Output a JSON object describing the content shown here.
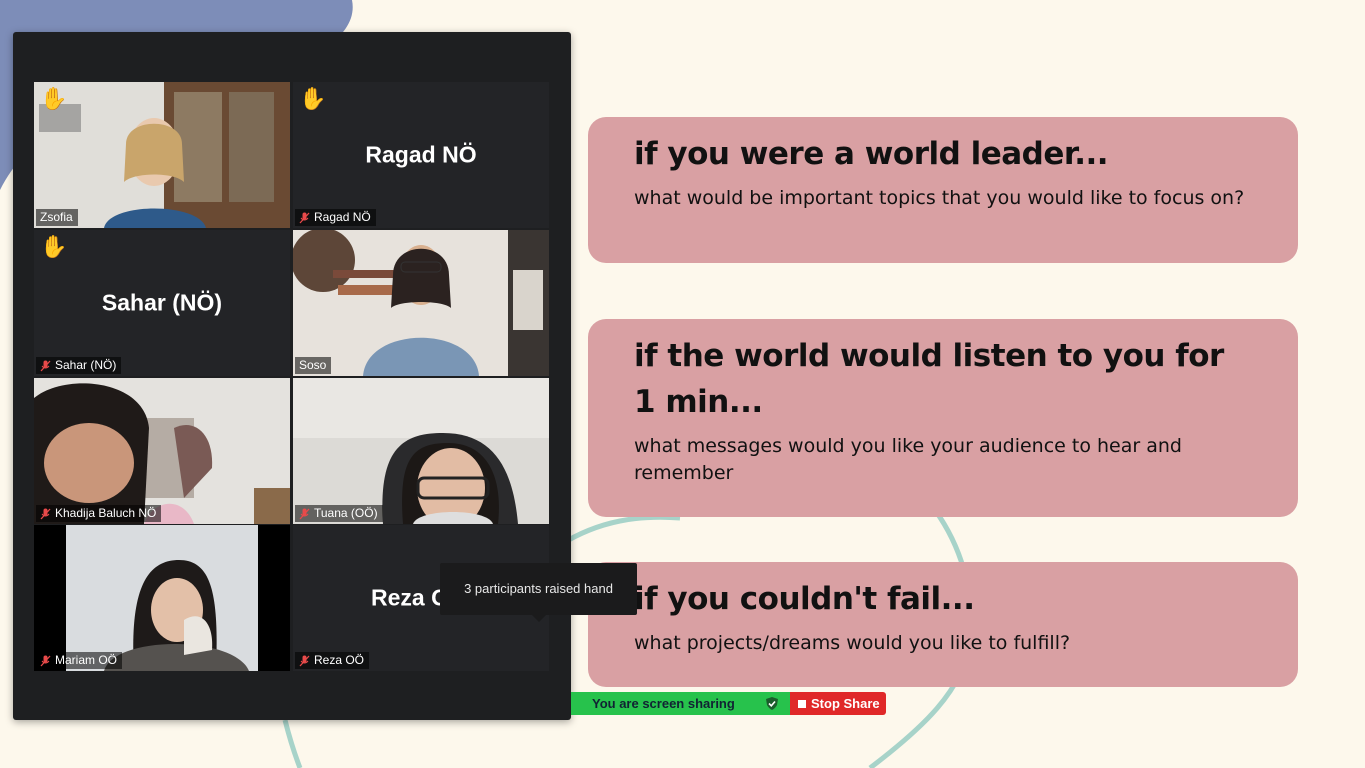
{
  "participants": [
    {
      "name_tag": "Zsofia",
      "center_name": "",
      "muted": false,
      "hand_raised": true
    },
    {
      "name_tag": "Ragad NÖ",
      "center_name": "Ragad NÖ",
      "muted": true,
      "hand_raised": true
    },
    {
      "name_tag": "Sahar (NÖ)",
      "center_name": "Sahar (NÖ)",
      "muted": true,
      "hand_raised": true
    },
    {
      "name_tag": "Soso",
      "center_name": "",
      "muted": false,
      "hand_raised": false
    },
    {
      "name_tag": "Khadija Baluch NÖ",
      "center_name": "",
      "muted": true,
      "hand_raised": false
    },
    {
      "name_tag": "Tuana (OÖ)",
      "center_name": "",
      "muted": true,
      "hand_raised": false
    },
    {
      "name_tag": "Mariam OÖ",
      "center_name": "",
      "muted": true,
      "hand_raised": false
    },
    {
      "name_tag": "Reza OÖ",
      "center_name": "Reza O",
      "muted": true,
      "hand_raised": false
    }
  ],
  "tooltip": {
    "text": "3 participants raised hand"
  },
  "slide": {
    "cards": [
      {
        "title": "if you were a world leader...",
        "body": "what would be important topics that you would like to focus on?"
      },
      {
        "title": "if the world would listen to you for 1 min...",
        "body": "what messages would you like your audience to hear and remember"
      },
      {
        "title": "if you couldn't fail...",
        "body": "what projects/dreams would you like to fulfill?"
      }
    ]
  },
  "share_bar": {
    "status": "You are screen sharing",
    "stop_label": "Stop Share"
  },
  "colors": {
    "card": "#d9a0a3",
    "share_green": "#27c24c",
    "stop_red": "#e02828",
    "active_speaker": "#c9e06a"
  }
}
